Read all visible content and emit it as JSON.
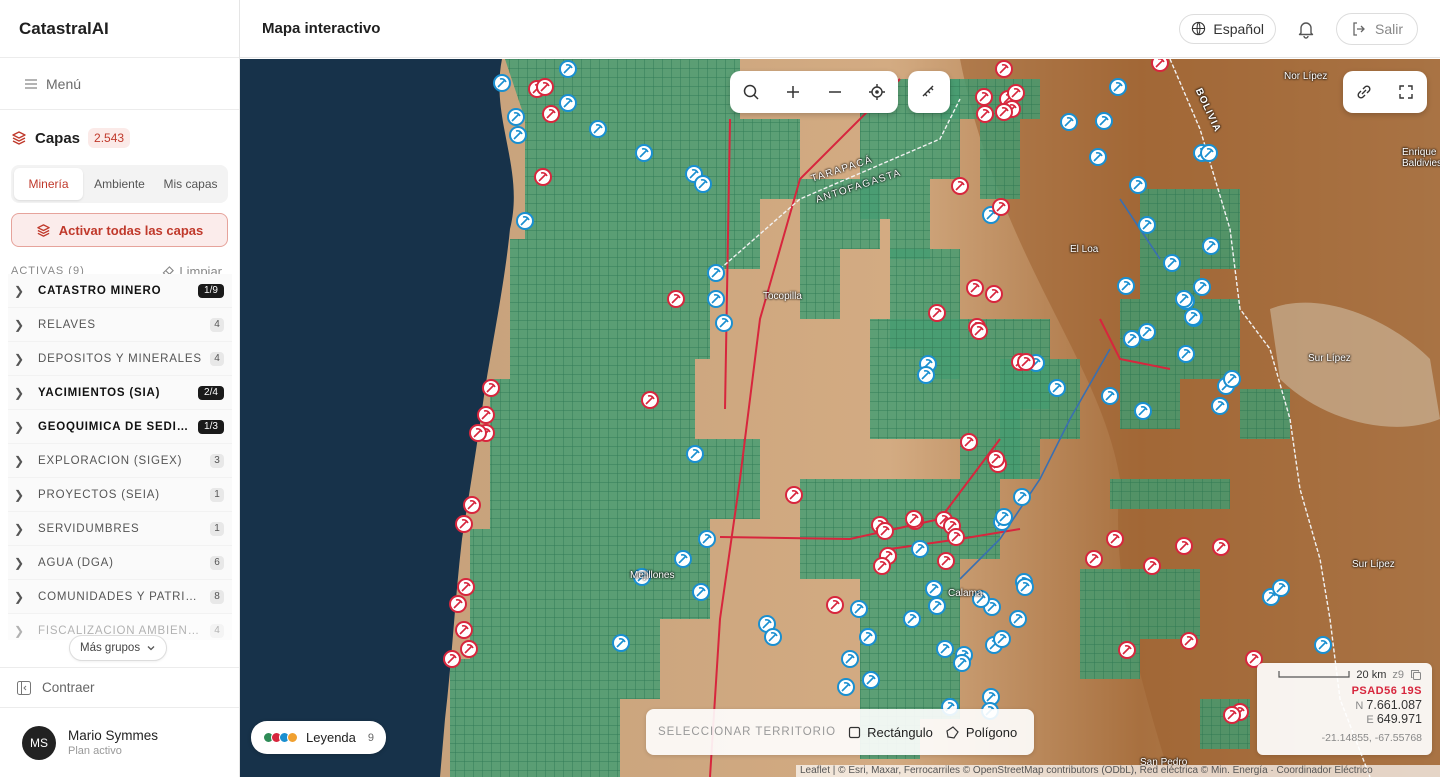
{
  "app": {
    "brand": "CatastralAI",
    "menu_label": "Menú"
  },
  "capas": {
    "title": "Capas",
    "count": "2.543"
  },
  "tabs": [
    {
      "label": "Minería",
      "active": true
    },
    {
      "label": "Ambiente",
      "active": false
    },
    {
      "label": "Mis capas",
      "active": false
    }
  ],
  "activate_all_label": "Activar todas las capas",
  "active_header": {
    "label": "ACTIVAS (9)",
    "clear_label": "Limpiar"
  },
  "groups": [
    {
      "name": "CATASTRO MINERO",
      "count": "1/9",
      "bold": true
    },
    {
      "name": "RELAVES",
      "count": "4",
      "bold": false
    },
    {
      "name": "DEPÓSITOS Y MINERALES",
      "count": "4",
      "bold": false
    },
    {
      "name": "YACIMIENTOS (SIA)",
      "count": "2/4",
      "bold": true
    },
    {
      "name": "GEOQUÍMICA DE SEDIMENTOS",
      "count": "1/3",
      "bold": true
    },
    {
      "name": "EXPLORACIÓN (SIGEX)",
      "count": "3",
      "bold": false
    },
    {
      "name": "PROYECTOS (SEIA)",
      "count": "1",
      "bold": false
    },
    {
      "name": "SERVIDUMBRES",
      "count": "1",
      "bold": false
    },
    {
      "name": "AGUA (DGA)",
      "count": "6",
      "bold": false
    },
    {
      "name": "COMUNIDADES Y PATRIMONIO",
      "count": "8",
      "bold": false
    },
    {
      "name": "FISCALIZACIÓN AMBIENTAL",
      "count": "4",
      "bold": false
    }
  ],
  "more_groups_label": "Más grupos",
  "collapse_label": "Contraer",
  "user": {
    "initials": "MS",
    "name": "Mario Symmes",
    "plan": "Plan activo"
  },
  "topbar": {
    "title": "Mapa interactivo",
    "language": "Español",
    "logout_label": "Salir"
  },
  "map": {
    "legend_label": "Leyenda",
    "legend_count": "9",
    "legend_colors": [
      "#2e8b57",
      "#d7263d",
      "#1a8fd0",
      "#f0a030"
    ],
    "territory": {
      "label": "SELECCIONAR TERRITORIO",
      "rect": "Rectángulo",
      "poly": "Polígono"
    },
    "scale": {
      "distance": "20 km",
      "zoom": "z9"
    },
    "projection": "PSAD56 19S",
    "north": "7.661.087",
    "east": "649.971",
    "latlon": "-21.14855, -67.55768",
    "attribution": "Leaflet | © Esri, Maxar, Ferrocarriles © OpenStreetMap contributors (ODbL), Red eléctrica © Min. Energía · Coordinador Eléctrico",
    "places": [
      "Nor Lípez",
      "BOLIVIA",
      "Enrique Baldivieso",
      "TARAPACÁ",
      "ANTOFAGASTA",
      "El Loa",
      "Tocopilla",
      "Sur Lípez",
      "Sur Lípez",
      "Mejillones",
      "Calama",
      "San Pedro"
    ],
    "colors": {
      "claims": "#3d9a6f",
      "marker_red": "#d7263d",
      "marker_blue": "#1a8fd0"
    }
  }
}
